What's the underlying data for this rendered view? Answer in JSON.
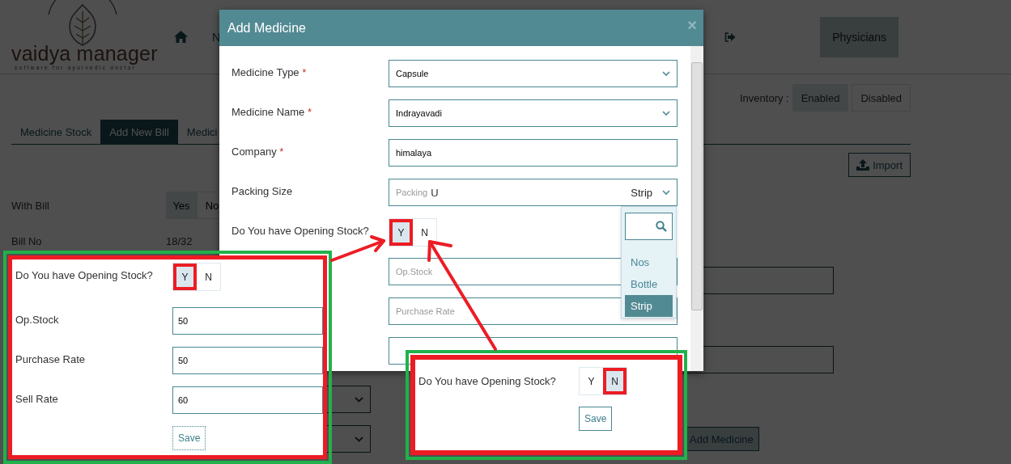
{
  "header": {
    "logo": {
      "name": "vaidya manager",
      "tagline": "software for ayurvedic doctor"
    },
    "nav_partial": "N",
    "nav_tab": "Physicians"
  },
  "inventory": {
    "label": "Inventory :",
    "options": [
      {
        "label": "Enabled",
        "selected": true
      },
      {
        "label": "Disabled",
        "selected": false
      }
    ]
  },
  "tabs": [
    {
      "label": "Medicine Stock",
      "selected": false
    },
    {
      "label": "Add New Bill",
      "selected": true
    },
    {
      "label": "Medici",
      "selected": false
    }
  ],
  "import_button": "Import",
  "with_bill": {
    "label": "With Bill",
    "options": [
      {
        "label": "Yes",
        "selected": true
      },
      {
        "label": "No",
        "selected": false
      }
    ]
  },
  "bill_no": {
    "label": "Bill No",
    "value": "18/32"
  },
  "add_medicine_button": "Add Medicine",
  "modal": {
    "title": "Add Medicine",
    "close": "×",
    "fields": [
      {
        "kind": "select",
        "label": "Medicine Type",
        "required_mark": "*",
        "value": "Capsule"
      },
      {
        "kind": "select",
        "label": "Medicine Name",
        "required_mark": "*",
        "value": "Indrayavadi"
      },
      {
        "kind": "text",
        "label": "Company",
        "required_mark": "*",
        "value": "himalaya"
      },
      {
        "kind": "packing",
        "label": "Packing Size",
        "placeholder": "Packing",
        "value": "U",
        "unit": "Strip"
      },
      {
        "kind": "toggle",
        "label": "Do You have Opening Stock?",
        "options": [
          {
            "label": "Y",
            "selected": true
          },
          {
            "label": "N",
            "selected": false
          }
        ]
      },
      {
        "kind": "text",
        "placeholder": "Op.Stock"
      },
      {
        "kind": "text",
        "placeholder": "Purchase Rate"
      },
      {
        "kind": "text"
      }
    ],
    "dropdown": {
      "options": [
        {
          "label": "Nos",
          "selected": false
        },
        {
          "label": "Bottle",
          "selected": false
        },
        {
          "label": "Strip",
          "selected": true
        }
      ]
    }
  },
  "callouts": [
    {
      "question": "Do You have Opening Stock?",
      "options": [
        {
          "label": "Y",
          "selected": true
        },
        {
          "label": "N",
          "selected": false
        }
      ],
      "fields": [
        {
          "label": "Op.Stock",
          "value": "50"
        },
        {
          "label": "Purchase Rate",
          "value": "50"
        },
        {
          "label": "Sell Rate",
          "value": "60"
        }
      ],
      "save": "Save"
    },
    {
      "question": "Do You have Opening Stock?",
      "options": [
        {
          "label": "Y",
          "selected": false
        },
        {
          "label": "N",
          "selected": true
        }
      ],
      "save": "Save"
    }
  ]
}
